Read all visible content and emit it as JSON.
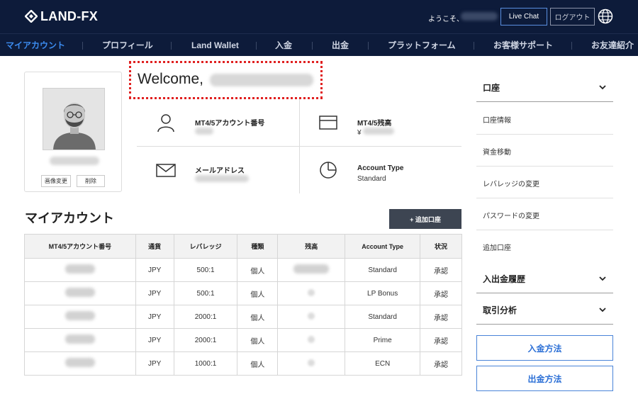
{
  "header": {
    "logo_text": "LAND-FX",
    "greeting": "ようこそ、",
    "live_chat": "Live Chat",
    "logout": "ログアウト",
    "globe_icon": "globe-icon"
  },
  "nav": {
    "items": [
      "マイアカウント",
      "プロフィール",
      "Land Wallet",
      "入金",
      "出金",
      "プラットフォーム",
      "お客様サポート",
      "お友達紹介"
    ],
    "active_color": "#3c8cf0"
  },
  "profile": {
    "change_image": "画像変更",
    "delete": "削除"
  },
  "welcome": {
    "title": "Welcome,"
  },
  "info": {
    "account_number_label": "MT4/5アカウント番号",
    "balance_label": "MT4/5残高",
    "balance_currency": "¥",
    "email_label": "メールアドレス",
    "account_type_label": "Account Type",
    "account_type_value": "Standard"
  },
  "accounts": {
    "title": "マイアカウント",
    "add_button": "+ 追加口座",
    "columns": [
      "MT4/5アカウント番号",
      "通貨",
      "レバレッジ",
      "種類",
      "残高",
      "Account Type",
      "状況"
    ],
    "rows": [
      {
        "currency": "JPY",
        "leverage": "500:1",
        "kind": "個人",
        "type": "Standard",
        "status": "承認"
      },
      {
        "currency": "JPY",
        "leverage": "500:1",
        "kind": "個人",
        "type": "LP Bonus",
        "status": "承認"
      },
      {
        "currency": "JPY",
        "leverage": "2000:1",
        "kind": "個人",
        "type": "Standard",
        "status": "承認"
      },
      {
        "currency": "JPY",
        "leverage": "2000:1",
        "kind": "個人",
        "type": "Prime",
        "status": "承認"
      },
      {
        "currency": "JPY",
        "leverage": "1000:1",
        "kind": "個人",
        "type": "ECN",
        "status": "承認"
      }
    ]
  },
  "sidebar": {
    "account_section": "口座",
    "items": [
      "口座情報",
      "資金移動",
      "レバレッジの変更",
      "パスワードの変更",
      "追加口座"
    ],
    "history_section": "入出金履歴",
    "analysis_section": "取引分析",
    "deposit_method": "入金方法",
    "withdraw_method": "出金方法"
  },
  "colors": {
    "header_bg": "#0d1b3a",
    "accent": "#2b6fd6",
    "highlight_border": "#e02020"
  }
}
